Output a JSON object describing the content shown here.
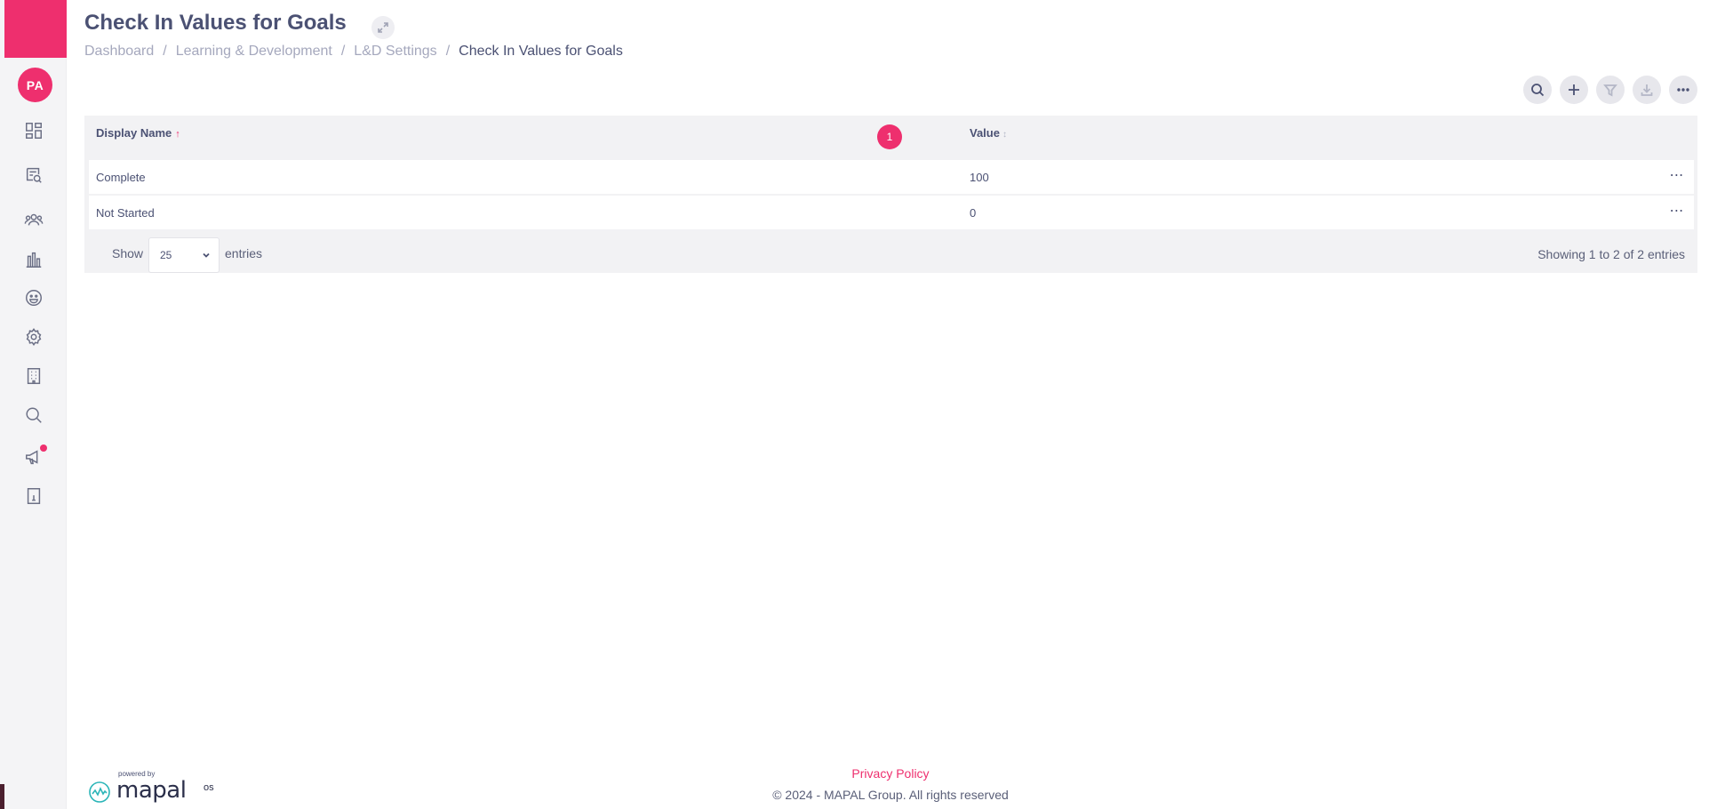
{
  "sidebar": {
    "avatar_initials": "PA",
    "notification_color": "#ee2f6e",
    "items": [
      {
        "name": "dashboard-icon"
      },
      {
        "name": "search-document-icon"
      },
      {
        "name": "people-icon"
      },
      {
        "name": "bar-chart-icon"
      },
      {
        "name": "smiley-icon"
      },
      {
        "name": "gear-icon"
      },
      {
        "name": "building-icon"
      },
      {
        "name": "search-icon"
      },
      {
        "name": "megaphone-icon"
      },
      {
        "name": "info-book-icon"
      }
    ]
  },
  "header": {
    "title": "Check In Values for Goals",
    "breadcrumb": [
      "Dashboard",
      "Learning & Development",
      "L&D Settings",
      "Check In Values for Goals"
    ],
    "separator": "/"
  },
  "toolbar": {
    "buttons": [
      "search-icon",
      "plus-icon",
      "filter-icon",
      "download-icon",
      "more-icon"
    ]
  },
  "table": {
    "columns": {
      "display_name": "Display Name",
      "value": "Value"
    },
    "rows": [
      {
        "display_name": "Complete",
        "value": "100"
      },
      {
        "display_name": "Not Started",
        "value": "0"
      }
    ],
    "show_label": "Show",
    "page_size": "25",
    "entries_label": "entries",
    "current_page": "1",
    "info": "Showing 1 to 2 of 2 entries"
  },
  "footer": {
    "powered_by": "powered by",
    "brand": "mapal",
    "brand_suffix": "os",
    "privacy": "Privacy Policy",
    "copyright": "© 2024 - MAPAL Group. All rights reserved"
  },
  "colors": {
    "accent": "#ee2f6e",
    "text": "#4b5173"
  }
}
